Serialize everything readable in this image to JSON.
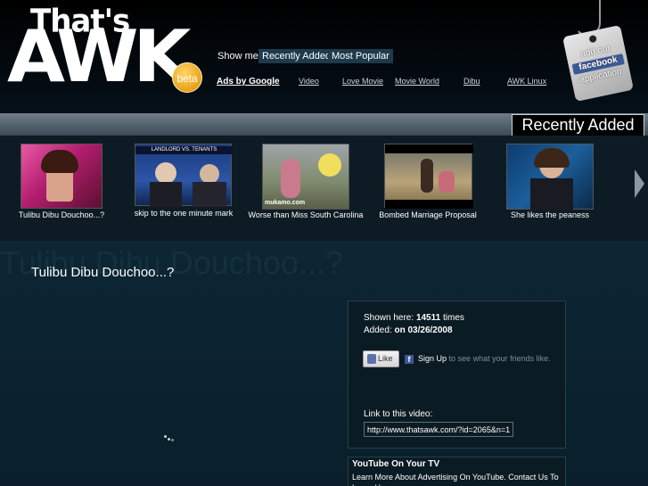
{
  "logo": {
    "line1": "That's",
    "line2": "AWK",
    "badge": "beta"
  },
  "header": {
    "show_me_label": "Show me:",
    "tabs": [
      {
        "label": "Recently Added"
      },
      {
        "label": "Most Popular"
      }
    ],
    "ads_label": "Ads by Google",
    "links": [
      {
        "label": "Video"
      },
      {
        "label": "Love Movie"
      },
      {
        "label": "Movie World"
      },
      {
        "label": "Dibu"
      },
      {
        "label": "AWK Linux"
      }
    ],
    "fb_tag": {
      "line1": "add our",
      "brand": "facebook",
      "line2": "application"
    }
  },
  "section_label": "Recently Added",
  "thumbnails": [
    {
      "caption": "Tulibu Dibu Douchoo...?"
    },
    {
      "caption": "skip to the one minute mark",
      "overlay": "LANDLORD VS. TENANTS"
    },
    {
      "caption": "Worse than Miss South Carolina",
      "overlay": "mukamo.com"
    },
    {
      "caption": "Bombed Marriage Proposal"
    },
    {
      "caption": "She likes the peaness"
    }
  ],
  "video": {
    "title": "Tulibu Dibu Douchoo...?"
  },
  "info": {
    "shown_label": "Shown here:",
    "shown_count": "14511",
    "shown_suffix": "times",
    "added_label": "Added:",
    "added_value": "on 03/26/2008",
    "like_label": "Like",
    "signup_link": "Sign Up",
    "signup_text": "to see what your friends like.",
    "link_label": "Link to this video:",
    "link_value": "http://www.thatsawk.com/?id=2065&n=1"
  },
  "ad": {
    "title": "YouTube On Your TV",
    "text": "Learn More About Advertising On YouTube. Contact Us To Learn How."
  },
  "colors": {
    "background": "#0b1f2c",
    "accent_tab": "#1e3a4c",
    "beta": "#e8a318",
    "facebook": "#3b5998"
  }
}
